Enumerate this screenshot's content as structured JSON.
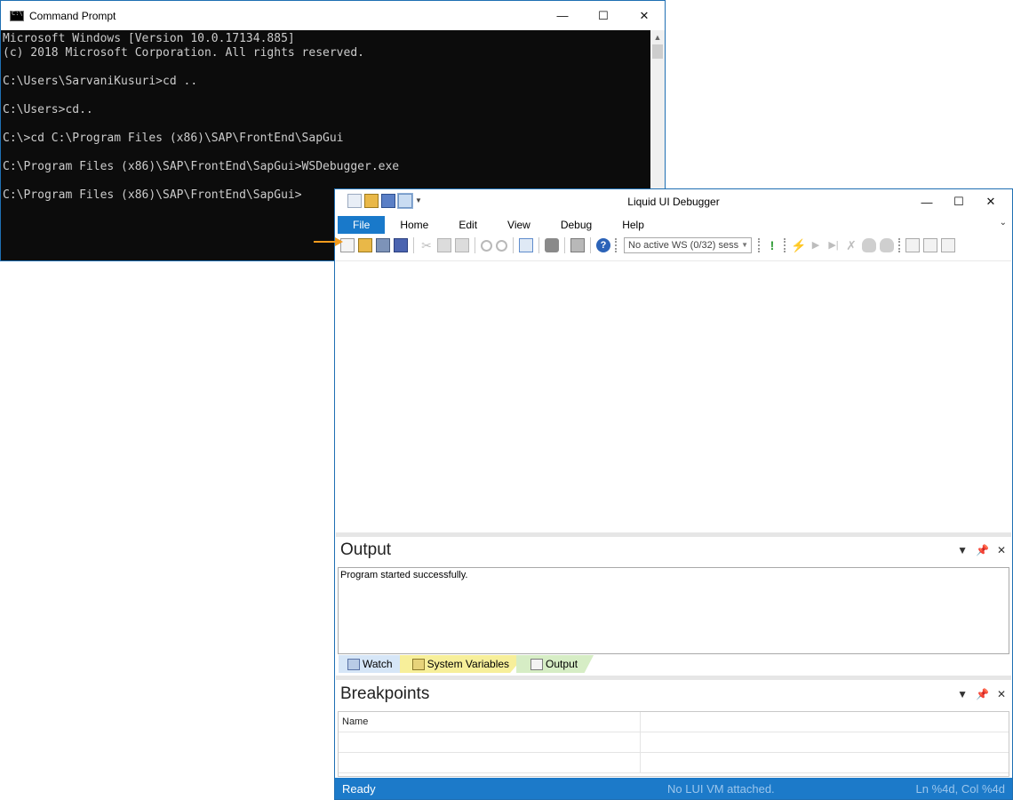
{
  "cmd": {
    "title": "Command Prompt",
    "lines": [
      "Microsoft Windows [Version 10.0.17134.885]",
      "(c) 2018 Microsoft Corporation. All rights reserved.",
      "",
      "C:\\Users\\SarvaniKusuri>cd ..",
      "",
      "C:\\Users>cd..",
      "",
      "C:\\>cd C:\\Program Files (x86)\\SAP\\FrontEnd\\SapGui",
      "",
      "C:\\Program Files (x86)\\SAP\\FrontEnd\\SapGui>WSDebugger.exe",
      "",
      "C:\\Program Files (x86)\\SAP\\FrontEnd\\SapGui>"
    ]
  },
  "debugger": {
    "title": "Liquid UI Debugger",
    "menu": [
      "File",
      "Home",
      "Edit",
      "View",
      "Debug",
      "Help"
    ],
    "ws_combo": "No active WS (0/32) sess",
    "output": {
      "title": "Output",
      "text": "Program started successfully."
    },
    "tabs": [
      "Watch",
      "System Variables",
      "Output"
    ],
    "breakpoints": {
      "title": "Breakpoints",
      "column_name": "Name"
    },
    "status": {
      "left": "Ready",
      "center": "No LUI VM attached.",
      "right": "Ln %4d, Col %4d"
    }
  },
  "colors": {
    "accent": "#1c7ac9",
    "arrow": "#f29b1d"
  }
}
